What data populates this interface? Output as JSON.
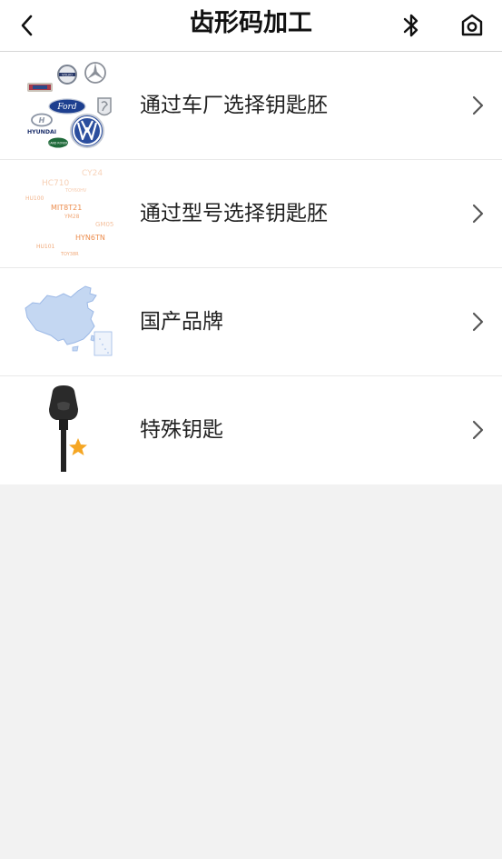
{
  "header": {
    "title": "齿形码加工",
    "back_icon": "chevron-left-icon",
    "bluetooth_icon": "bluetooth-icon",
    "home_icon": "camera-home-icon"
  },
  "menu": {
    "items": [
      {
        "label": "通过车厂选择钥匙胚",
        "thumbnail": "car-brand-logos"
      },
      {
        "label": "通过型号选择钥匙胚",
        "thumbnail": "key-model-word-cloud"
      },
      {
        "label": "国产品牌",
        "thumbnail": "china-map"
      },
      {
        "label": "特殊钥匙",
        "thumbnail": "key-with-star"
      }
    ]
  },
  "brand_logos": {
    "ford": "Ford",
    "hyundai": "HYUNDAI",
    "land_rover": "LAND ROVER",
    "volvo": "VOLVO"
  },
  "word_cloud": {
    "words": [
      "CY24",
      "HC710",
      "TOY60HV",
      "HU100",
      "MIT8T21",
      "YM28",
      "GM05",
      "HYN6TN",
      "HU101",
      "TOY38R"
    ]
  },
  "colors": {
    "header_bg": "#ffffff",
    "page_bg": "#f2f2f2",
    "chevron": "#555555",
    "word_cloud": "#f0a878",
    "star": "#f5a623"
  }
}
